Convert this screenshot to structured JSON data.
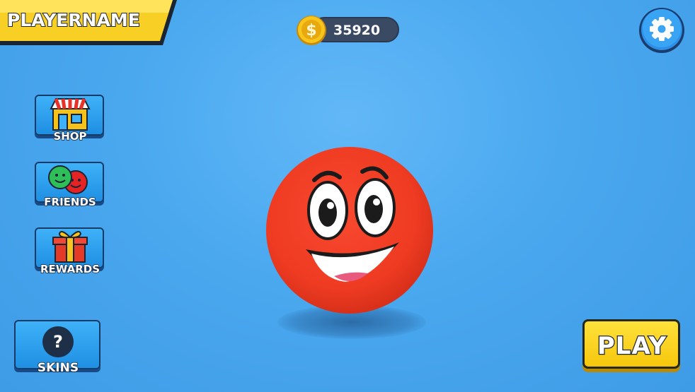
{
  "player": {
    "name": "PLAYERNAME"
  },
  "currency": {
    "coins": "35920",
    "icon": "coin-icon"
  },
  "menu": {
    "shop_label": "SHOP",
    "friends_label": "FRIENDS",
    "rewards_label": "REWARDS",
    "skins_label": "SKINS",
    "skins_placeholder": "?"
  },
  "actions": {
    "play_label": "PLAY",
    "settings_icon": "gear-icon"
  },
  "colors": {
    "background": "#4aa8ef",
    "ball": "#f2402a",
    "button_blue": "#2a9cef",
    "play_yellow": "#f6c60c",
    "banner_yellow": "#f7d12a"
  }
}
